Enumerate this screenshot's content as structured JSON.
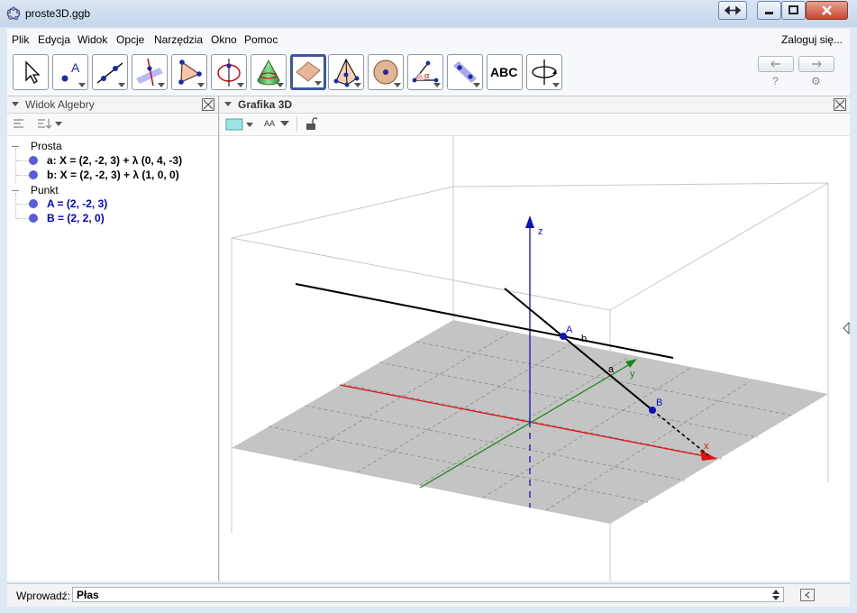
{
  "window": {
    "title": "proste3D.ggb"
  },
  "menu": {
    "items": [
      "Plik",
      "Edycja",
      "Widok",
      "Opcje",
      "Narzędzia",
      "Okno",
      "Pomoc"
    ],
    "login": "Zaloguj się..."
  },
  "toolbar": {
    "tools": [
      "move-tool-icon",
      "point-tool-icon",
      "line-tool-icon",
      "perpendicular-line-tool-icon",
      "polygon-tool-icon",
      "circle-axis-tool-icon",
      "pyramid-cone-tool-icon",
      "plane-tool-icon",
      "prism-tool-icon",
      "sphere-tool-icon",
      "angle-tool-icon",
      "reflect-tool-icon",
      "text-tool-icon",
      "rotate-view-tool-icon"
    ],
    "text_tool_label": "ABC",
    "help_label": "?",
    "settings_label": "⚙"
  },
  "algebra": {
    "title": "Widok Algebry",
    "categories": [
      {
        "name": "Prosta",
        "items": [
          "a: X = (2, -2, 3) + λ (0, 4, -3)",
          "b: X = (2, -2, 3) + λ (1, 0, 0)"
        ],
        "color": "#000000"
      },
      {
        "name": "Punkt",
        "items": [
          "A = (2, -2, 3)",
          "B = (2, 2, 0)"
        ],
        "color": "#0000cc"
      }
    ]
  },
  "graphics": {
    "title": "Grafika 3D",
    "style_label": "AA",
    "axis_labels": {
      "x": "x",
      "y": "y",
      "z": "z"
    },
    "point_labels": {
      "A": "A",
      "B": "B"
    },
    "line_labels": {
      "a": "a",
      "b": "b"
    },
    "colors": {
      "x_axis": "#e01010",
      "y_axis": "#1a8a1a",
      "z_axis": "#1010c0",
      "plane": "#c0c0c0",
      "point": "#1010c0"
    }
  },
  "input": {
    "label": "Wprowadź:",
    "value": "Płas"
  }
}
